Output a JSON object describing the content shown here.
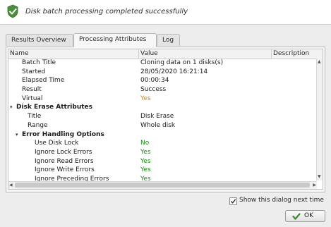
{
  "header": {
    "message": "Disk batch processing completed successfully",
    "icon": "success-shield-check-icon"
  },
  "tabs": [
    {
      "label": "Results Overview",
      "active": false
    },
    {
      "label": "Processing Attributes",
      "active": true
    },
    {
      "label": "Log",
      "active": false
    }
  ],
  "grid": {
    "columns": {
      "name": "Name",
      "value": "Value",
      "description": "Description"
    },
    "rows": [
      {
        "name": "Batch Title",
        "value": "Cloning data on 1 disks(s)",
        "level": 1,
        "bold": false,
        "toggle": "",
        "color": ""
      },
      {
        "name": "Started",
        "value": "28/05/2020 16:21:14",
        "level": 1,
        "bold": false,
        "toggle": "",
        "color": ""
      },
      {
        "name": "Elapsed Time",
        "value": "00:00:34",
        "level": 1,
        "bold": false,
        "toggle": "",
        "color": ""
      },
      {
        "name": "Result",
        "value": "Success",
        "level": 1,
        "bold": false,
        "toggle": "",
        "color": ""
      },
      {
        "name": "Virtual",
        "value": "Yes",
        "level": 1,
        "bold": false,
        "toggle": "",
        "color": "#d98a00"
      },
      {
        "name": "Disk Erase Attributes",
        "value": "",
        "level": 0,
        "bold": true,
        "toggle": "▾",
        "color": ""
      },
      {
        "name": "Title",
        "value": "Disk Erase",
        "level": 2,
        "bold": false,
        "toggle": "",
        "color": ""
      },
      {
        "name": "Range",
        "value": "Whole disk",
        "level": 2,
        "bold": false,
        "toggle": "",
        "color": ""
      },
      {
        "name": "Error Handling Options",
        "value": "",
        "level": 1,
        "bold": true,
        "toggle": "▾",
        "color": ""
      },
      {
        "name": "Use Disk Lock",
        "value": "No",
        "level": 3,
        "bold": false,
        "toggle": "",
        "color": "#1a8a1a"
      },
      {
        "name": "Ignore Lock Errors",
        "value": "Yes",
        "level": 3,
        "bold": false,
        "toggle": "",
        "color": "#1a8a1a"
      },
      {
        "name": "Ignore Read Errors",
        "value": "Yes",
        "level": 3,
        "bold": false,
        "toggle": "",
        "color": "#1a8a1a"
      },
      {
        "name": "Ignore Write Errors",
        "value": "Yes",
        "level": 3,
        "bold": false,
        "toggle": "",
        "color": "#1a8a1a"
      },
      {
        "name": "Ignore Preceding Errors",
        "value": "Yes",
        "level": 3,
        "bold": false,
        "toggle": "",
        "color": "#1a8a1a"
      }
    ]
  },
  "footer": {
    "show_dialog_label": "Show this dialog next time",
    "show_dialog_checked": true,
    "ok_label": "OK"
  },
  "colors": {
    "yes_orange": "#d98a00",
    "green": "#1a8a1a"
  }
}
